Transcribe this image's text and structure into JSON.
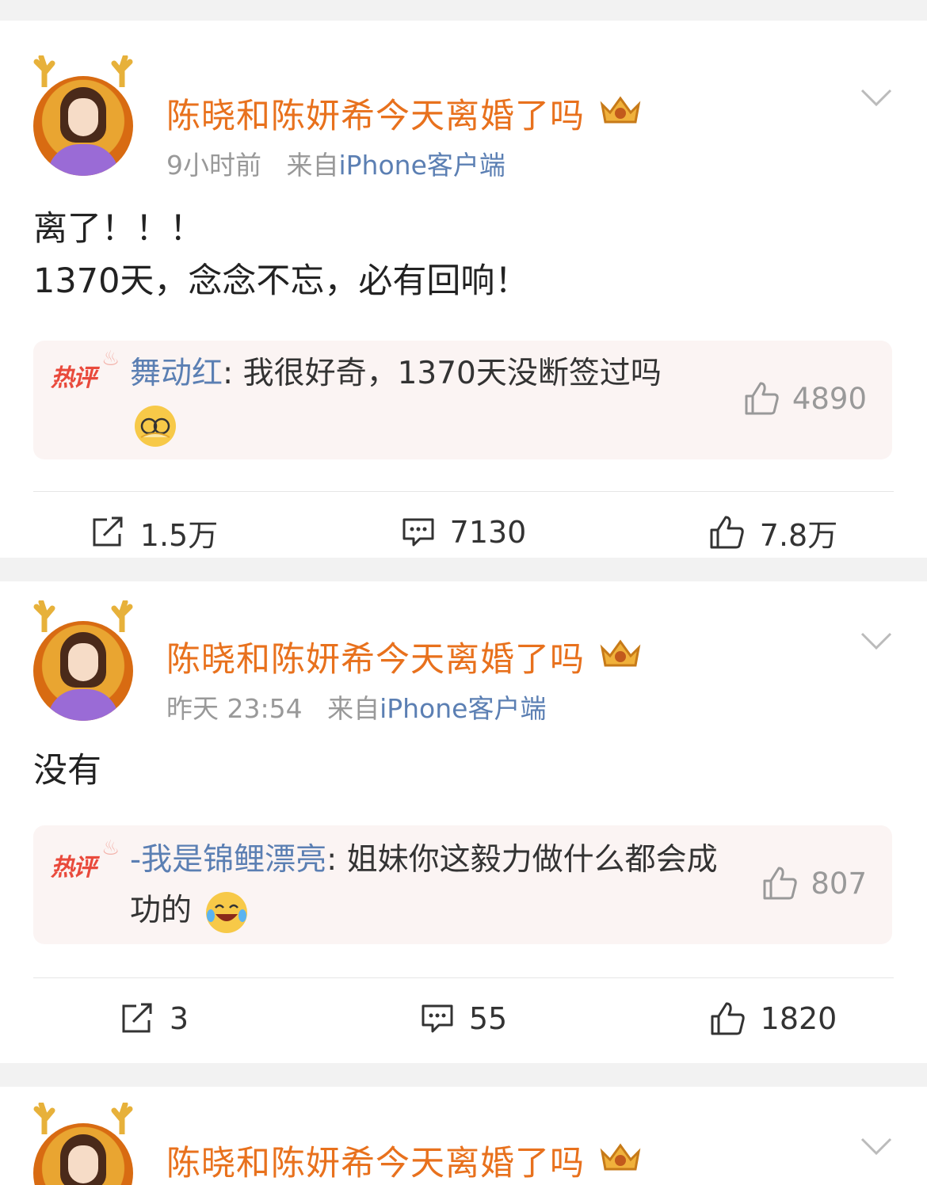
{
  "posts": [
    {
      "author": "陈晓和陈妍希今天离婚了吗",
      "time": "9小时前",
      "source_prefix": "来自",
      "source": "iPhone客户端",
      "content": "离了！！！\n1370天，念念不忘，必有回响！",
      "hot_badge": "热评",
      "hot_user": "舞动红",
      "hot_text": "我很好奇，1370天没断签过吗",
      "hot_emoji": "facepalm-emoji",
      "hot_likes": "4890",
      "repost_count": "1.5万",
      "comment_count": "7130",
      "like_count": "7.8万"
    },
    {
      "author": "陈晓和陈妍希今天离婚了吗",
      "time": "昨天 23:54",
      "source_prefix": "来自",
      "source": "iPhone客户端",
      "content": "没有",
      "hot_badge": "热评",
      "hot_user": "-我是锦鲤漂亮",
      "hot_text": "姐妹你这毅力做什么都会成功的",
      "hot_emoji": "laughing-tears-emoji",
      "hot_likes": "807",
      "repost_count": "3",
      "comment_count": "55",
      "like_count": "1820"
    },
    {
      "author": "陈晓和陈妍希今天离婚了吗"
    }
  ],
  "colors": {
    "author": "#e8711d",
    "link": "#5b7fb3",
    "hot_badge": "#e94a3c",
    "hot_bg": "#fbf4f3"
  }
}
